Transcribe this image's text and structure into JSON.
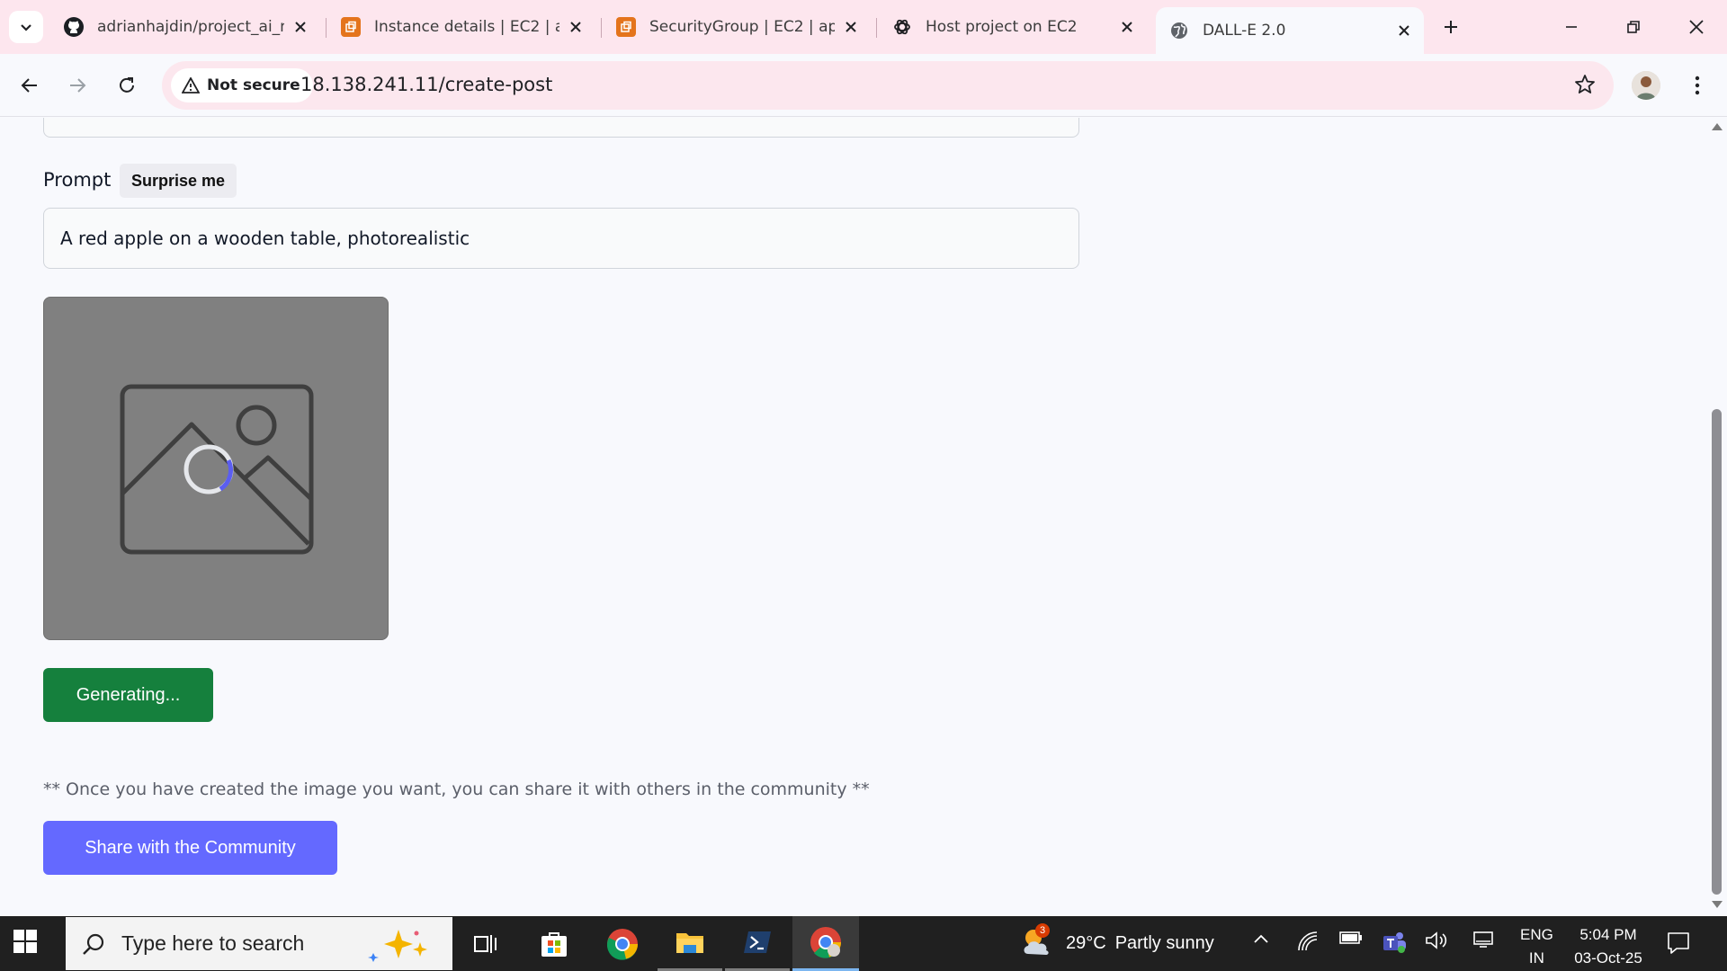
{
  "browser": {
    "tabs": [
      {
        "title": "adrianhajdin/project_ai_m",
        "icon": "github-icon",
        "active": false
      },
      {
        "title": "Instance details | EC2 | ap",
        "icon": "aws-icon",
        "active": false
      },
      {
        "title": "SecurityGroup | EC2 | ap-",
        "icon": "aws-icon",
        "active": false
      },
      {
        "title": "Host project on EC2",
        "icon": "openai-icon",
        "active": false
      },
      {
        "title": "DALL-E 2.0",
        "icon": "globe-icon",
        "active": true
      }
    ],
    "security_label": "Not secure",
    "url": "18.138.241.11/create-post"
  },
  "form": {
    "prompt_label": "Prompt",
    "surprise_label": "Surprise me",
    "prompt_value": "A red apple on a wooden table, photorealistic",
    "generate_label": "Generating...",
    "share_note": "** Once you have created the image you want, you can share it with others in the community **",
    "share_label": "Share with the Community"
  },
  "taskbar": {
    "search_placeholder": "Type here to search",
    "weather_temp": "29°C",
    "weather_desc": "Partly sunny",
    "weather_badge": "3",
    "lang_top": "ENG",
    "lang_bottom": "IN",
    "time": "5:04 PM",
    "date": "03-Oct-25"
  },
  "colors": {
    "generate_button": "#15803d",
    "share_button": "#6469ff",
    "tabstrip": "#fde6ee",
    "spinner_accent": "#5b5ef0"
  }
}
